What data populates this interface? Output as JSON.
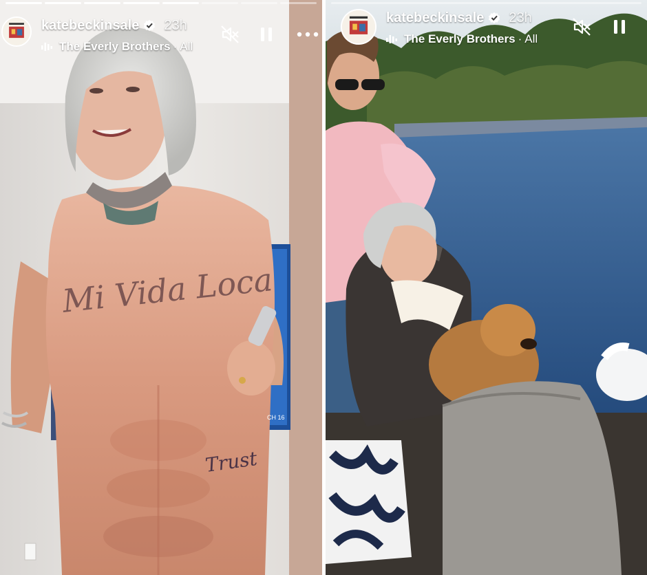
{
  "stories": [
    {
      "username": "katebeckinsale",
      "time_ago": "23h",
      "music_artist": "The Everly Brothers",
      "music_separator": "·",
      "music_scope": "All",
      "shirt_text_1": "Mi Vida Loca",
      "shirt_text_2": "Trust",
      "tv_text": "CH 16"
    },
    {
      "username": "katebeckinsale",
      "time_ago": "23h",
      "music_artist": "The Everly Brothers",
      "music_separator": "·",
      "music_scope": "All"
    }
  ],
  "icons": {
    "mute": "speaker-muted-icon",
    "pause": "pause-icon",
    "more": "more-dots-icon",
    "verified": "verified-badge-icon",
    "music": "music-bars-icon"
  },
  "colors": {
    "text": "#ffffff",
    "verified_bg": "#ffffff",
    "verified_check": "#3a3a3a"
  }
}
